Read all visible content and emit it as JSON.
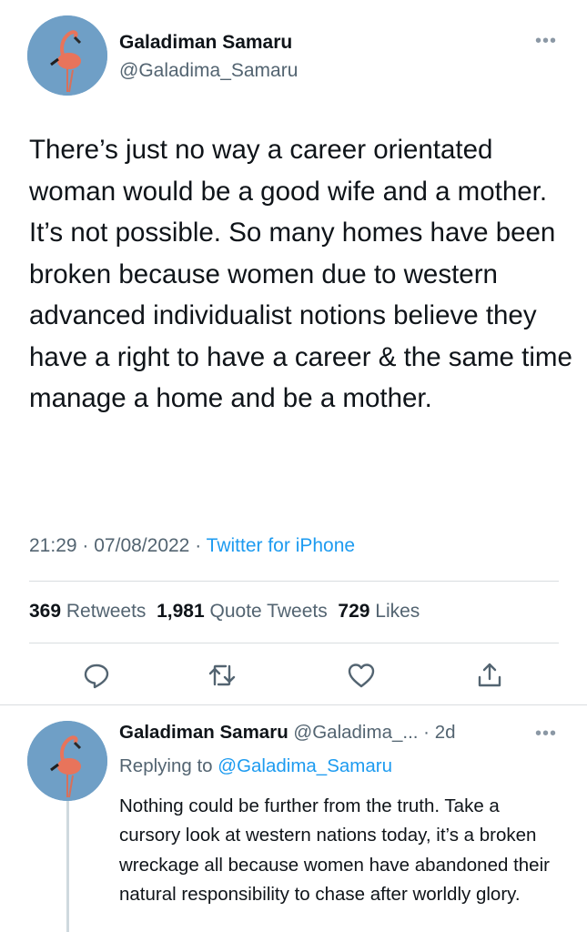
{
  "tweet": {
    "author_name": "Galadiman Samaru",
    "author_handle": "@Galadima_Samaru",
    "more_label": "•••",
    "text": "There’s just no way a career orientated woman would be a good wife and a mother. It’s not possible. So many homes have been broken because women due to western advanced individualist notions believe they have a right to have a career & the same time manage a home and be a mother.",
    "time": "21:29",
    "date": "07/08/2022",
    "separator": "·",
    "source": "Twitter for iPhone"
  },
  "stats": {
    "retweets_count": "369",
    "retweets_label": "Retweets",
    "quotes_count": "1,981",
    "quotes_label": "Quote Tweets",
    "likes_count": "729",
    "likes_label": "Likes"
  },
  "actions": [
    {
      "icon": "reply-icon"
    },
    {
      "icon": "retweet-icon"
    },
    {
      "icon": "like-icon"
    },
    {
      "icon": "share-icon"
    }
  ],
  "reply": {
    "author_name": "Galadiman Samaru",
    "author_handle": "@Galadima_...",
    "age": "· 2d",
    "more_label": "•••",
    "replying_prefix": "Replying to",
    "replying_to": "@Galadima_Samaru",
    "text": "Nothing could be further from the truth. Take a cursory look at western nations today, it’s a broken wreckage all because women have abandoned their natural responsibility to chase after worldly glory."
  },
  "colors": {
    "accent": "#1d9bf0",
    "secondary_text": "#536471",
    "avatar_bg": "#6f9fc6",
    "flamingo": "#e8745b"
  }
}
